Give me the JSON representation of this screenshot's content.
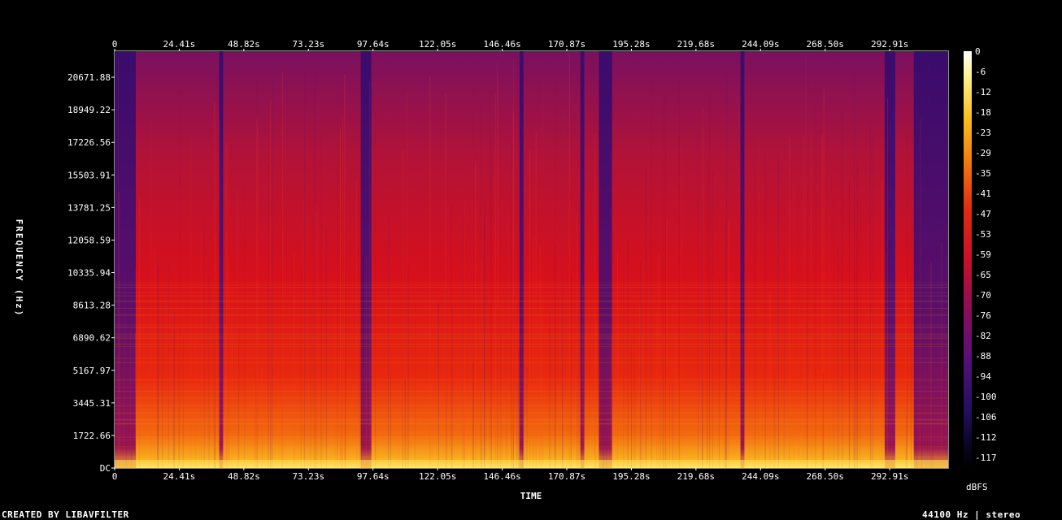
{
  "chart_data": {
    "type": "heatmap",
    "title": "",
    "xlabel": "TIME",
    "ylabel": "FREQUENCY (Hz)",
    "x_ticks": [
      "0",
      "24.41s",
      "48.82s",
      "73.23s",
      "97.64s",
      "122.05s",
      "146.46s",
      "170.87s",
      "195.28s",
      "219.68s",
      "244.09s",
      "268.50s",
      "292.91s"
    ],
    "y_ticks": [
      "DC",
      "1722.66",
      "3445.31",
      "5167.97",
      "6890.62",
      "8613.28",
      "10335.94",
      "12058.59",
      "13781.25",
      "15503.91",
      "17226.56",
      "18949.22",
      "20671.88"
    ],
    "xlim": [
      0,
      315
    ],
    "ylim": [
      0,
      22050
    ],
    "colorbar": {
      "label": "dBFS",
      "ticks": [
        "0",
        "-6",
        "-12",
        "-18",
        "-23",
        "-29",
        "-35",
        "-41",
        "-47",
        "-53",
        "-59",
        "-65",
        "-70",
        "-76",
        "-82",
        "-88",
        "-94",
        "-100",
        "-106",
        "-112",
        "-117"
      ],
      "range": [
        -117,
        0
      ]
    },
    "quiet_segments_s": [
      [
        0,
        8
      ],
      [
        39.5,
        41
      ],
      [
        93,
        97
      ],
      [
        153,
        154.5
      ],
      [
        176,
        177.5
      ],
      [
        183,
        188
      ],
      [
        236.5,
        238
      ],
      [
        291,
        295
      ],
      [
        302,
        315
      ]
    ]
  },
  "footer": {
    "credit": "CREATED BY LIBAVFILTER",
    "info": "44100 Hz | stereo"
  }
}
